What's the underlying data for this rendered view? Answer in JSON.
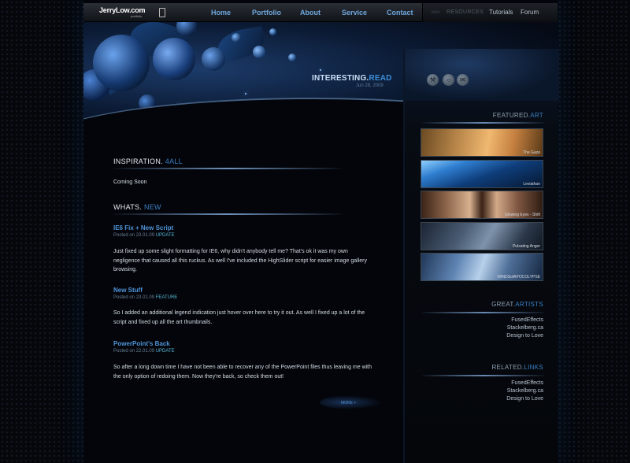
{
  "nav": {
    "logo_main": "JerryLow.com",
    "logo_sub": "portfolio",
    "items": [
      "Home",
      "Portfolio",
      "About",
      "Service",
      "Contact"
    ],
    "arrows": ">>>",
    "resources_label": "RESOURCES",
    "right_items": [
      "Tutorials",
      "Forum"
    ]
  },
  "header": {
    "title_main": "INTERESTING.",
    "title_accent": "READ",
    "date": "Jun 28, 2009"
  },
  "main": {
    "inspiration": {
      "title_main": "INSPIRATION.",
      "title_accent": "4ALL",
      "text": "Coming Soon"
    },
    "whats": {
      "title_main": "WHATS.",
      "title_accent": "NEW"
    },
    "posts": [
      {
        "title": "IE6 Fix + New Script",
        "meta_prefix": "Posted on 23.01.09",
        "category": "UPDATE",
        "body": "Just fixed up some slight formatting for IE6, why didn't anybody tell me? That's ok it was my own negligence that caused all this ruckus. As well I've included the HighSlider script for easier image gallery browsing."
      },
      {
        "title": "New Stuff",
        "meta_prefix": "Posted on 23.01.09",
        "category": "FEATURE",
        "body": "So I added an additional legend indication just hover over here to try it out. As well I fixed up a lot of the script and fixed up all the art thumbnails."
      },
      {
        "title": "PowerPoint's Back",
        "meta_prefix": "Posted on 22.01.09",
        "category": "UPDATE",
        "body": "So after a long down time I have not been able to recover any of the PowerPoint files thus leaving me with the only option of redoing them. Now they're back, so check them out!"
      }
    ],
    "more_label": "MORE +"
  },
  "sidebar": {
    "icons": [
      "tools-icon",
      "chat-icon",
      "mail-icon"
    ],
    "featured": {
      "title_main": "FEATURED.",
      "title_accent": "ART",
      "thumbs": [
        "The Gaze",
        "Leviathan",
        "Glowing Eyes - Shift",
        "Pulsating Anger",
        "WINDSofAPOCOLYPSE"
      ]
    },
    "artists": {
      "title_main": "GREAT.",
      "title_accent": "ARTISTS",
      "links": [
        "FusedEffects",
        "Stackelberg.ca",
        "Design to Love"
      ]
    },
    "related": {
      "title_main": "RELATED.",
      "title_accent": "LINKS",
      "links": [
        "FusedEffects",
        "Stackelberg.ca",
        "Design to Love"
      ]
    }
  },
  "colors": {
    "accent": "#3b7fc4",
    "link": "#4f95d8",
    "update": "#57b6d8"
  }
}
